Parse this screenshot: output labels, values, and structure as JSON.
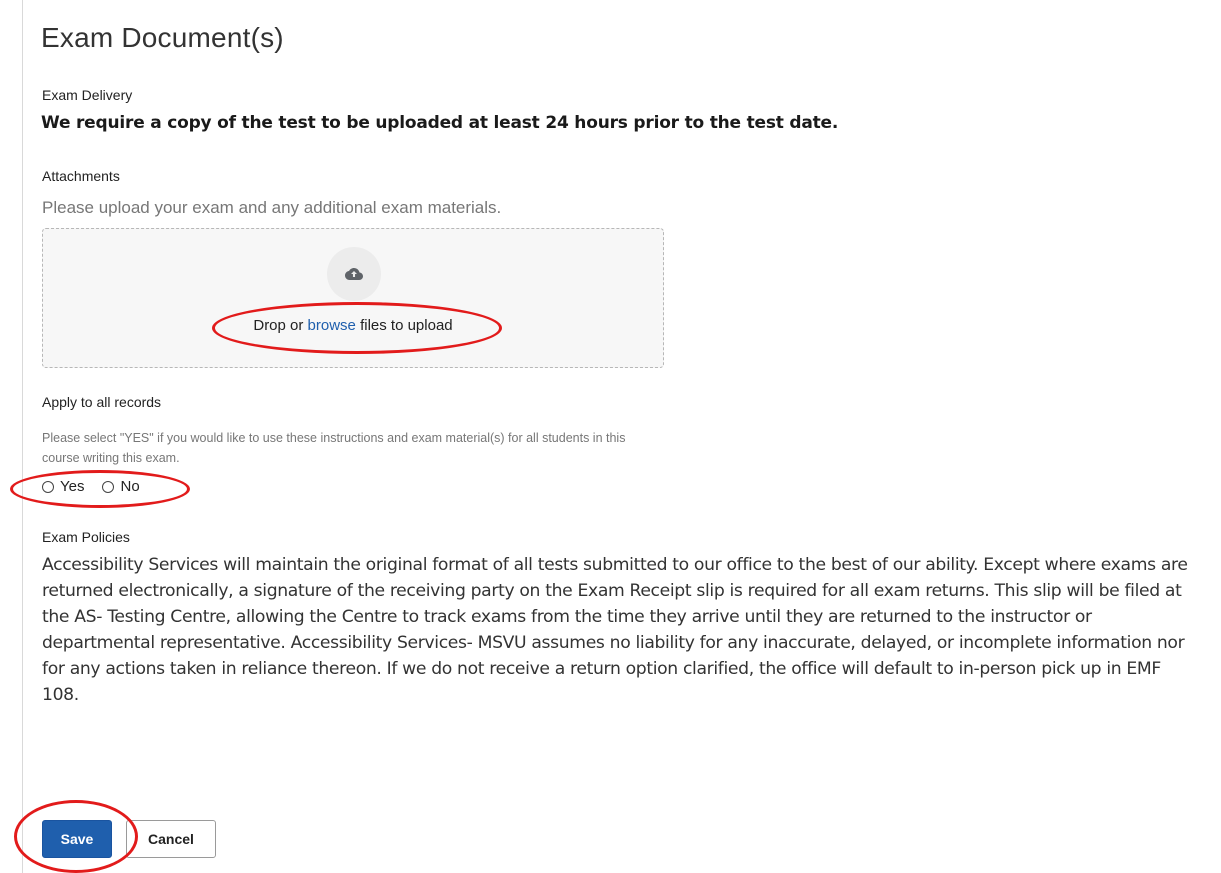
{
  "page": {
    "title": "Exam Document(s)"
  },
  "exam_delivery": {
    "label": "Exam Delivery",
    "note": "We require a copy of the test to be uploaded at least 24 hours prior to the test date."
  },
  "attachments": {
    "label": "Attachments",
    "help": "Please upload your exam and any additional exam materials.",
    "dropzone": {
      "icon": "cloud-upload-icon",
      "text_before": "Drop or ",
      "link": "browse",
      "text_after": " files to upload"
    }
  },
  "apply_all": {
    "label": "Apply to all records",
    "help": "Please select \"YES\" if you would like to use these instructions and exam material(s) for all students in this course writing this exam.",
    "options": [
      {
        "label": "Yes",
        "selected": false
      },
      {
        "label": "No",
        "selected": false
      }
    ]
  },
  "policies": {
    "label": "Exam Policies",
    "text": "Accessibility Services will maintain the original format of all tests submitted to our office to the best of our ability. Except where exams are returned electronically, a signature of the receiving party on the Exam Receipt slip is required for all exam returns. This slip will be filed at the AS- Testing Centre, allowing the Centre to track exams from the time they arrive until they are returned to the instructor or departmental representative. Accessibility Services- MSVU assumes no liability for any inaccurate, delayed, or incomplete information nor for any actions taken in reliance thereon. If we do not receive a return option clarified, the office will default to in-person pick up in EMF 108."
  },
  "actions": {
    "save_label": "Save",
    "cancel_label": "Cancel"
  },
  "colors": {
    "primary": "#1f5fad",
    "annotation": "#e21b1b"
  }
}
